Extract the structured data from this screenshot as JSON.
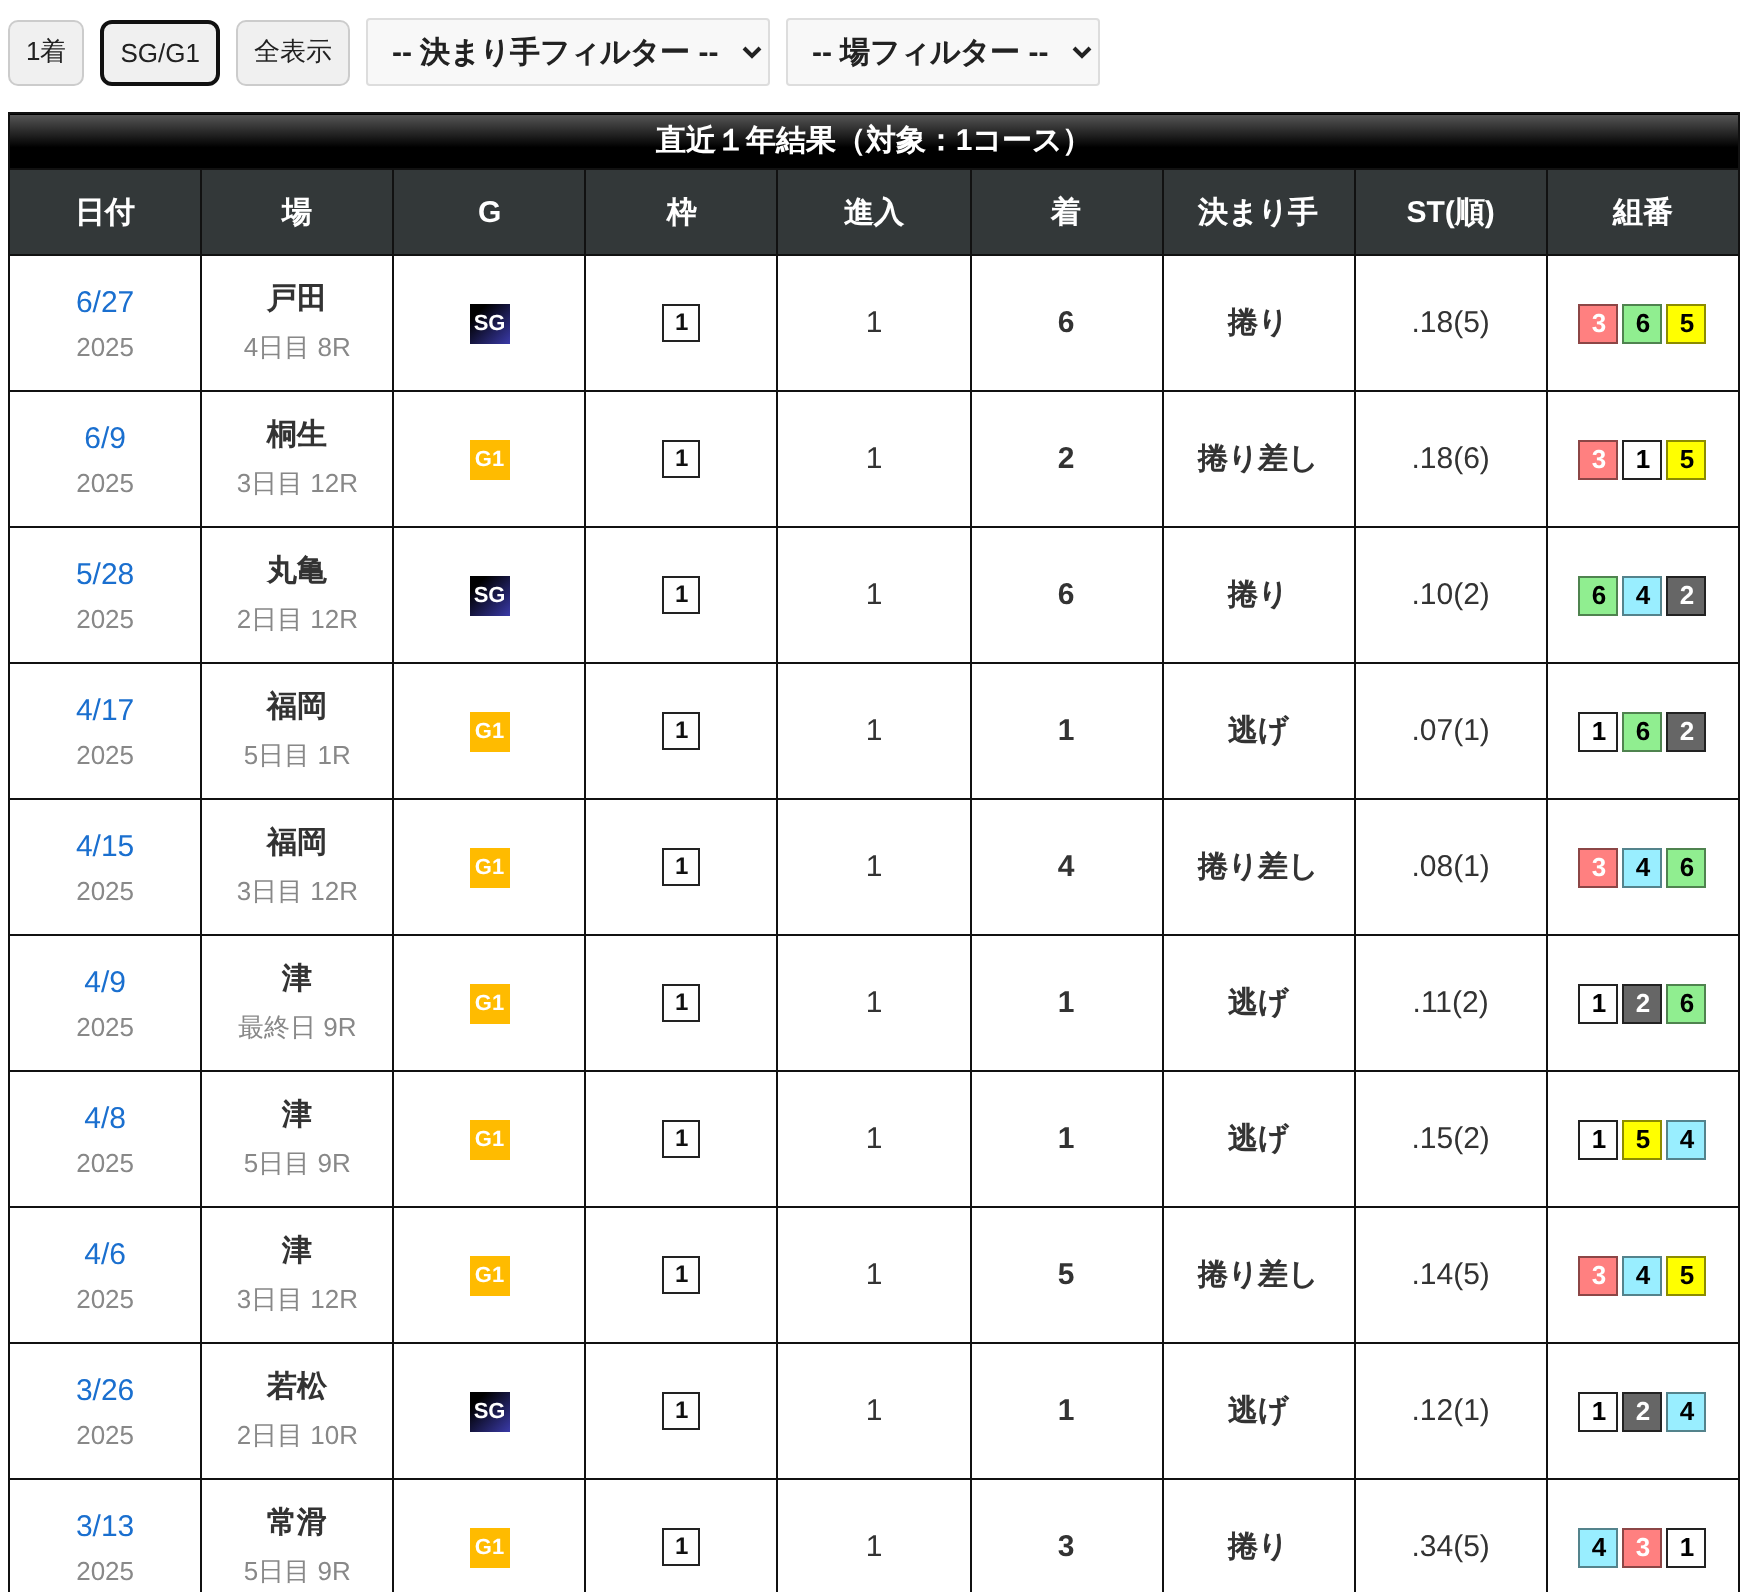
{
  "toolbar": {
    "buttons": [
      {
        "label": "1着",
        "selected": false
      },
      {
        "label": "SG/G1",
        "selected": true
      },
      {
        "label": "全表示",
        "selected": false
      }
    ],
    "filters": [
      {
        "value": "-- 決まり手フィルター --"
      },
      {
        "value": "-- 場フィルター --"
      }
    ]
  },
  "table": {
    "title": "直近１年結果（対象：1コース）",
    "columns": [
      "日付",
      "場",
      "G",
      "枠",
      "進入",
      "着",
      "決まり手",
      "ST(順)",
      "組番"
    ],
    "rows": [
      {
        "date": "6/27",
        "year": "2025",
        "venue": "戸田",
        "race": "4日目 8R",
        "grade": {
          "label": "SG",
          "kind": "sg"
        },
        "frame": "1",
        "entry": "1",
        "finish": "6",
        "technique": "捲り",
        "st": ".18(5)",
        "combo": [
          {
            "num": "3",
            "color": "#ff8080"
          },
          {
            "num": "6",
            "color": "#90ee90"
          },
          {
            "num": "5",
            "color": "#ffff00"
          }
        ]
      },
      {
        "date": "6/9",
        "year": "2025",
        "venue": "桐生",
        "race": "3日目 12R",
        "grade": {
          "label": "G1",
          "kind": "g1"
        },
        "frame": "1",
        "entry": "1",
        "finish": "2",
        "technique": "捲り差し",
        "st": ".18(6)",
        "combo": [
          {
            "num": "3",
            "color": "#ff8080"
          },
          {
            "num": "1",
            "color": "#ffffff"
          },
          {
            "num": "5",
            "color": "#ffff00"
          }
        ]
      },
      {
        "date": "5/28",
        "year": "2025",
        "venue": "丸亀",
        "race": "2日目 12R",
        "grade": {
          "label": "SG",
          "kind": "sg"
        },
        "frame": "1",
        "entry": "1",
        "finish": "6",
        "technique": "捲り",
        "st": ".10(2)",
        "combo": [
          {
            "num": "6",
            "color": "#90ee90"
          },
          {
            "num": "4",
            "color": "#99eeff"
          },
          {
            "num": "2",
            "color": "#666666"
          }
        ]
      },
      {
        "date": "4/17",
        "year": "2025",
        "venue": "福岡",
        "race": "5日目 1R",
        "grade": {
          "label": "G1",
          "kind": "g1"
        },
        "frame": "1",
        "entry": "1",
        "finish": "1",
        "technique": "逃げ",
        "st": ".07(1)",
        "combo": [
          {
            "num": "1",
            "color": "#ffffff"
          },
          {
            "num": "6",
            "color": "#90ee90"
          },
          {
            "num": "2",
            "color": "#666666"
          }
        ]
      },
      {
        "date": "4/15",
        "year": "2025",
        "venue": "福岡",
        "race": "3日目 12R",
        "grade": {
          "label": "G1",
          "kind": "g1"
        },
        "frame": "1",
        "entry": "1",
        "finish": "4",
        "technique": "捲り差し",
        "st": ".08(1)",
        "combo": [
          {
            "num": "3",
            "color": "#ff8080"
          },
          {
            "num": "4",
            "color": "#99eeff"
          },
          {
            "num": "6",
            "color": "#90ee90"
          }
        ]
      },
      {
        "date": "4/9",
        "year": "2025",
        "venue": "津",
        "race": "最終日 9R",
        "grade": {
          "label": "G1",
          "kind": "g1"
        },
        "frame": "1",
        "entry": "1",
        "finish": "1",
        "technique": "逃げ",
        "st": ".11(2)",
        "combo": [
          {
            "num": "1",
            "color": "#ffffff"
          },
          {
            "num": "2",
            "color": "#666666"
          },
          {
            "num": "6",
            "color": "#90ee90"
          }
        ]
      },
      {
        "date": "4/8",
        "year": "2025",
        "venue": "津",
        "race": "5日目 9R",
        "grade": {
          "label": "G1",
          "kind": "g1"
        },
        "frame": "1",
        "entry": "1",
        "finish": "1",
        "technique": "逃げ",
        "st": ".15(2)",
        "combo": [
          {
            "num": "1",
            "color": "#ffffff"
          },
          {
            "num": "5",
            "color": "#ffff00"
          },
          {
            "num": "4",
            "color": "#99eeff"
          }
        ]
      },
      {
        "date": "4/6",
        "year": "2025",
        "venue": "津",
        "race": "3日目 12R",
        "grade": {
          "label": "G1",
          "kind": "g1"
        },
        "frame": "1",
        "entry": "1",
        "finish": "5",
        "technique": "捲り差し",
        "st": ".14(5)",
        "combo": [
          {
            "num": "3",
            "color": "#ff8080"
          },
          {
            "num": "4",
            "color": "#99eeff"
          },
          {
            "num": "5",
            "color": "#ffff00"
          }
        ]
      },
      {
        "date": "3/26",
        "year": "2025",
        "venue": "若松",
        "race": "2日目 10R",
        "grade": {
          "label": "SG",
          "kind": "sg"
        },
        "frame": "1",
        "entry": "1",
        "finish": "1",
        "technique": "逃げ",
        "st": ".12(1)",
        "combo": [
          {
            "num": "1",
            "color": "#ffffff"
          },
          {
            "num": "2",
            "color": "#666666"
          },
          {
            "num": "4",
            "color": "#99eeff"
          }
        ]
      },
      {
        "date": "3/13",
        "year": "2025",
        "venue": "常滑",
        "race": "5日目 9R",
        "grade": {
          "label": "G1",
          "kind": "g1"
        },
        "frame": "1",
        "entry": "1",
        "finish": "3",
        "technique": "捲り",
        "st": ".34(5)",
        "combo": [
          {
            "num": "4",
            "color": "#99eeff"
          },
          {
            "num": "3",
            "color": "#ff8080"
          },
          {
            "num": "1",
            "color": "#ffffff"
          }
        ]
      }
    ]
  }
}
